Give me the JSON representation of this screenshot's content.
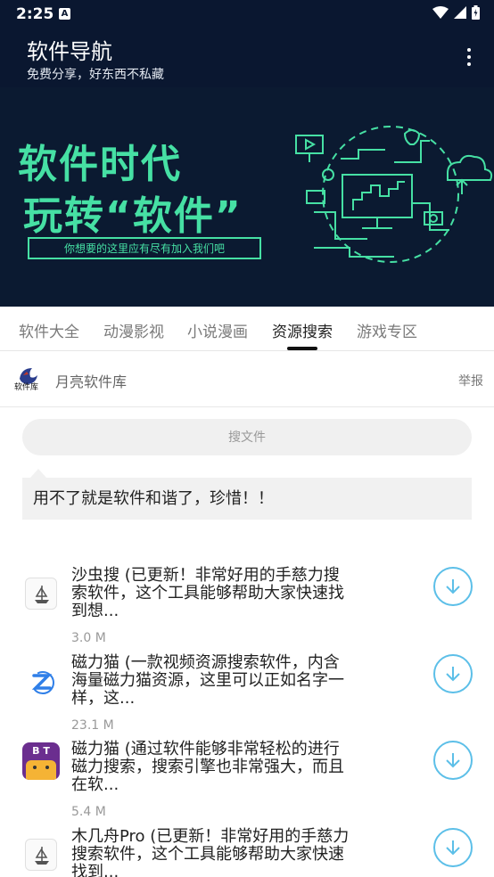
{
  "status": {
    "time": "2:25",
    "notif_letter": "A"
  },
  "app_bar": {
    "title": "软件导航",
    "subtitle": "免费分享，好东西不私藏"
  },
  "banner": {
    "line1": "软件时代",
    "line2": "玩转“软件”",
    "box_text": "你想要的这里应有尽有加入我们吧"
  },
  "tabs": [
    {
      "label": "软件大全",
      "active": false
    },
    {
      "label": "动漫影视",
      "active": false
    },
    {
      "label": "小说漫画",
      "active": false
    },
    {
      "label": "资源搜索",
      "active": true
    },
    {
      "label": "游戏专区",
      "active": false
    }
  ],
  "source": {
    "name": "月亮软件库",
    "report": "举报",
    "logo_text": "软件库"
  },
  "search": {
    "placeholder": "搜文件"
  },
  "note": "用不了就是软件和谐了，珍惜！！",
  "apps": [
    {
      "desc": "沙虫搜 (已更新！非常好用的手慈力搜索软件，这个工具能够帮助大家快速找到想...",
      "size": "3.0 M",
      "icon": "ship-icon"
    },
    {
      "desc": "磁力猫 (一款视频资源搜索软件，内含海量磁力猫资源，这里可以正如名字一样，这...",
      "size": "23.1 M",
      "icon": "magnet-cat-icon"
    },
    {
      "desc": "磁力猫 (通过软件能够非常轻松的进行磁力搜索，搜索引擎也非常强大，而且在软...",
      "size": "5.4 M",
      "icon": "bt-cat-icon",
      "icon_text": "B T"
    },
    {
      "desc": "木几舟Pro (已更新！非常好用的手慈力搜索软件，这个工具能够帮助大家快速找到...",
      "size": "",
      "icon": "ship-icon"
    }
  ],
  "colors": {
    "header_bg": "#0a1730",
    "banner_green": "#46e0a4",
    "download_blue": "#5cbfe8"
  }
}
